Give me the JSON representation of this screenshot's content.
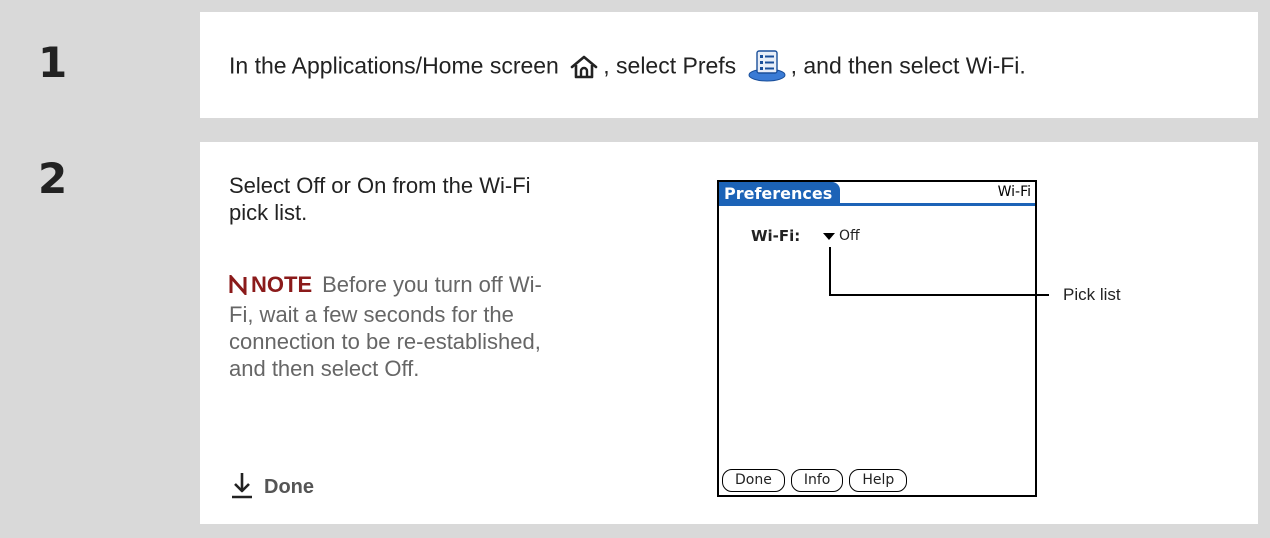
{
  "steps": [
    {
      "number": "1",
      "text_before": "In the Applications/Home screen",
      "text_middle": ", select Prefs",
      "text_after": ", and then select Wi-Fi.",
      "icons": [
        "home-icon",
        "prefs-app-icon"
      ]
    },
    {
      "number": "2",
      "instruction": "Select Off or On from the Wi-Fi pick list.",
      "note": {
        "label": "NOTE",
        "text": "Before you turn off Wi-Fi, wait a few seconds for the connection to be re-established, and then select Off."
      },
      "done_label": "Done"
    }
  ],
  "device": {
    "app_title": "Preferences",
    "screen_name": "Wi-Fi",
    "field_label": "Wi-Fi:",
    "field_value": "Off",
    "buttons": [
      "Done",
      "Info",
      "Help"
    ],
    "callout": "Pick list",
    "accent_color": "#1c63b7"
  },
  "colors": {
    "note_label": "#8b1a1a",
    "background_band": "#d9d9d9"
  }
}
